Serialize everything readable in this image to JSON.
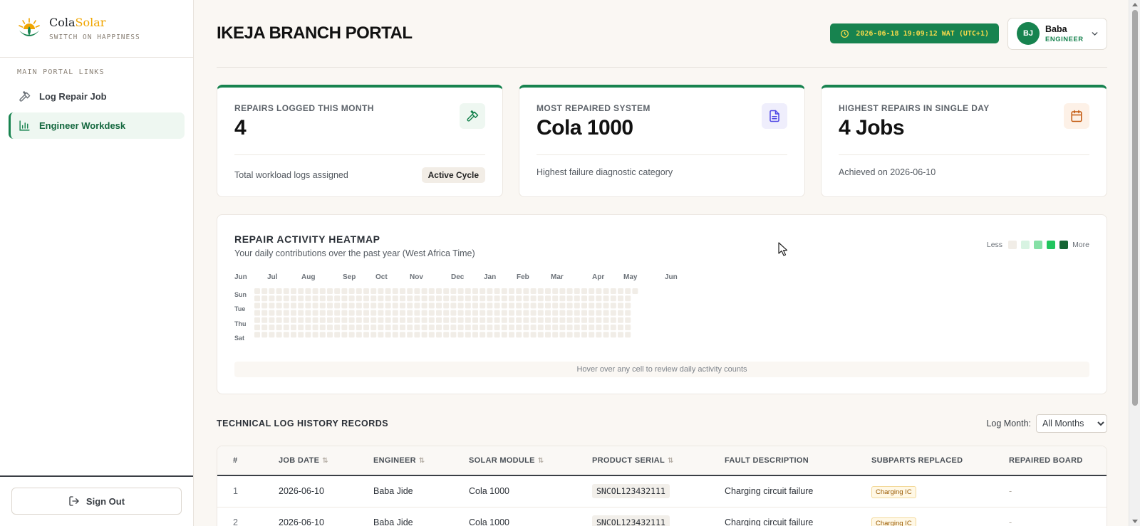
{
  "brand": {
    "name_part1": "Cola",
    "name_part2": "Solar",
    "tagline": "SWITCH ON HAPPINESS"
  },
  "sidebar": {
    "heading": "MAIN PORTAL LINKS",
    "items": [
      {
        "label": "Log Repair Job",
        "icon": "hammer-icon",
        "active": false
      },
      {
        "label": "Engineer Workdesk",
        "icon": "bar-chart-icon",
        "active": true
      }
    ],
    "signout_label": "Sign Out"
  },
  "header": {
    "title": "IKEJA BRANCH PORTAL",
    "clock": "2026-06-18 19:09:12 WAT (UTC+1)",
    "user": {
      "initials": "BJ",
      "name": "Baba",
      "role": "ENGINEER"
    }
  },
  "stats": [
    {
      "label": "REPAIRS LOGGED THIS MONTH",
      "value": "4",
      "foot": "Total workload logs assigned",
      "badge": "Active Cycle",
      "icon": "hammer-icon",
      "accent": "#17834f"
    },
    {
      "label": "MOST REPAIRED SYSTEM",
      "value": "Cola 1000",
      "foot": "Highest failure diagnostic category",
      "badge": "",
      "icon": "document-icon",
      "accent": "#4f46e5"
    },
    {
      "label": "HIGHEST REPAIRS IN SINGLE DAY",
      "value": "4 Jobs",
      "foot": "Achieved on 2026-06-10",
      "badge": "",
      "icon": "calendar-icon",
      "accent": "#c2570c"
    }
  ],
  "heatmap": {
    "title": "REPAIR ACTIVITY HEATMAP",
    "subtitle": "Your daily contributions over the past year (West Africa Time)",
    "legend_less": "Less",
    "legend_more": "More",
    "legend_colors": [
      "#f1ede7",
      "#d8f3e2",
      "#86e0a6",
      "#22c55e",
      "#166534"
    ],
    "months": [
      "Jun",
      "Jul",
      "Aug",
      "Sep",
      "Oct",
      "Nov",
      "Dec",
      "Jan",
      "Feb",
      "Mar",
      "Apr",
      "May",
      "Jun"
    ],
    "day_labels": [
      "Sun",
      "Tue",
      "Thu",
      "Sat"
    ],
    "weeks": 53,
    "active_cells": [
      {
        "week": 52,
        "day": 3,
        "level": 3
      }
    ],
    "hint": "Hover over any cell to review daily activity counts"
  },
  "log": {
    "title": "TECHNICAL LOG HISTORY RECORDS",
    "filter_label": "Log Month:",
    "filter_value": "All Months",
    "columns": [
      {
        "label": "#",
        "sortable": false
      },
      {
        "label": "JOB DATE",
        "sortable": true
      },
      {
        "label": "ENGINEER",
        "sortable": true
      },
      {
        "label": "SOLAR MODULE",
        "sortable": true
      },
      {
        "label": "PRODUCT SERIAL",
        "sortable": true
      },
      {
        "label": "FAULT DESCRIPTION",
        "sortable": false
      },
      {
        "label": "SUBPARTS REPLACED",
        "sortable": false
      },
      {
        "label": "REPAIRED BOARD",
        "sortable": false
      }
    ],
    "rows": [
      {
        "idx": "1",
        "date": "2026-06-10",
        "engineer": "Baba Jide",
        "module": "Cola 1000",
        "serial": "SNCOL123432111",
        "fault": "Charging circuit failure",
        "subparts": "Charging IC",
        "board": "-"
      },
      {
        "idx": "2",
        "date": "2026-06-10",
        "engineer": "Baba Jide",
        "module": "Cola 1000",
        "serial": "SNCOL123432111",
        "fault": "Charging circuit failure",
        "subparts": "Charging IC",
        "board": "-"
      }
    ]
  }
}
